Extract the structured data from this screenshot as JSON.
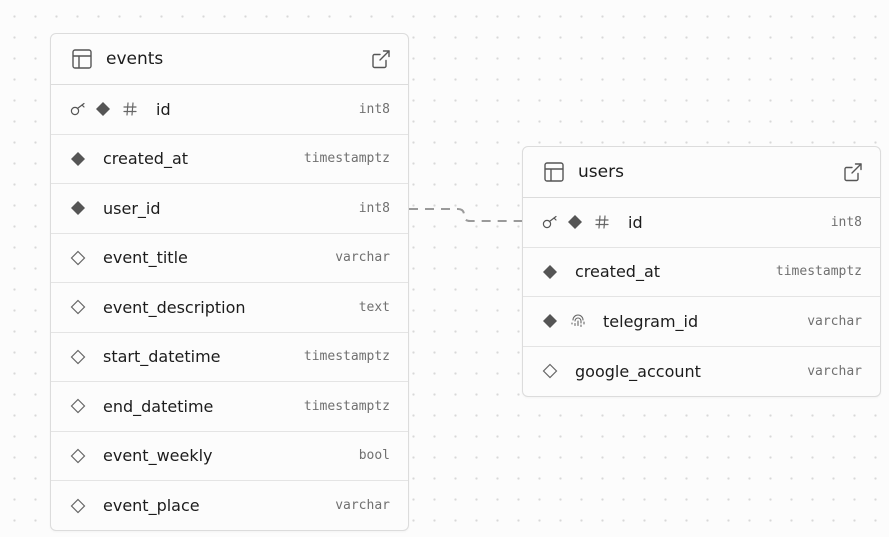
{
  "tables": [
    {
      "name": "events",
      "columns": [
        {
          "name": "id",
          "type": "int8",
          "primary_key": true,
          "nullable": false,
          "identity": true,
          "unique": false
        },
        {
          "name": "created_at",
          "type": "timestamptz",
          "primary_key": false,
          "nullable": false,
          "identity": false,
          "unique": false
        },
        {
          "name": "user_id",
          "type": "int8",
          "primary_key": false,
          "nullable": false,
          "identity": false,
          "unique": false
        },
        {
          "name": "event_title",
          "type": "varchar",
          "primary_key": false,
          "nullable": true,
          "identity": false,
          "unique": false
        },
        {
          "name": "event_description",
          "type": "text",
          "primary_key": false,
          "nullable": true,
          "identity": false,
          "unique": false
        },
        {
          "name": "start_datetime",
          "type": "timestamptz",
          "primary_key": false,
          "nullable": true,
          "identity": false,
          "unique": false
        },
        {
          "name": "end_datetime",
          "type": "timestamptz",
          "primary_key": false,
          "nullable": true,
          "identity": false,
          "unique": false
        },
        {
          "name": "event_weekly",
          "type": "bool",
          "primary_key": false,
          "nullable": true,
          "identity": false,
          "unique": false
        },
        {
          "name": "event_place",
          "type": "varchar",
          "primary_key": false,
          "nullable": true,
          "identity": false,
          "unique": false
        }
      ]
    },
    {
      "name": "users",
      "columns": [
        {
          "name": "id",
          "type": "int8",
          "primary_key": true,
          "nullable": false,
          "identity": true,
          "unique": false
        },
        {
          "name": "created_at",
          "type": "timestamptz",
          "primary_key": false,
          "nullable": false,
          "identity": false,
          "unique": false
        },
        {
          "name": "telegram_id",
          "type": "varchar",
          "primary_key": false,
          "nullable": false,
          "identity": false,
          "unique": true
        },
        {
          "name": "google_account",
          "type": "varchar",
          "primary_key": false,
          "nullable": true,
          "identity": false,
          "unique": false
        }
      ]
    }
  ],
  "relations": [
    {
      "from_table": "events",
      "from_column": "user_id",
      "to_table": "users",
      "to_column": "id",
      "style": "dashed"
    }
  ],
  "colors": {
    "background": "#fcfcfc",
    "canvas_dot": "#d8d8d8",
    "border": "#dcdcdc",
    "text": "#1c1c1c",
    "type_text": "#707070",
    "icon": "#555555",
    "relation_line": "#9a9a9a"
  },
  "icons": {
    "table": "table-grid-icon",
    "open": "external-link-icon",
    "primary_key": "key-icon",
    "not_null": "diamond-filled-icon",
    "nullable": "diamond-outline-icon",
    "identity": "hash-icon",
    "unique": "fingerprint-icon"
  }
}
